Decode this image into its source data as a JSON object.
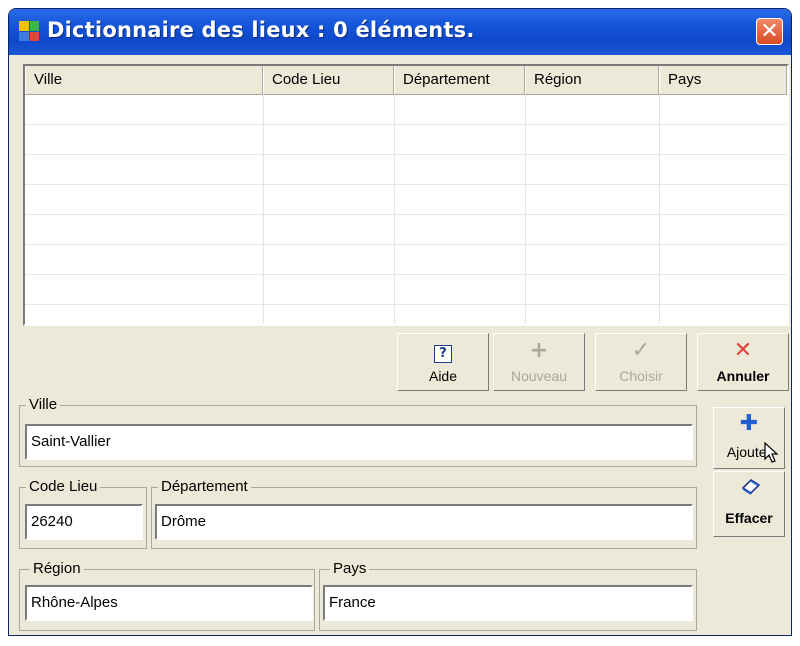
{
  "window": {
    "title": "Dictionnaire des lieux : 0 éléments.",
    "close_glyph": "✕"
  },
  "grid": {
    "columns": [
      "Ville",
      "Code Lieu",
      "Département",
      "Région",
      "Pays"
    ],
    "rows": []
  },
  "toolbar": {
    "help": {
      "label": "Aide",
      "icon": "help-icon",
      "glyph": "?"
    },
    "new": {
      "label": "Nouveau",
      "icon": "plus-icon",
      "glyph": "+",
      "disabled": true
    },
    "choose": {
      "label": "Choisir",
      "icon": "checkmark-icon",
      "glyph": "✓",
      "disabled": true
    },
    "cancel": {
      "label": "Annuler",
      "icon": "x-icon",
      "glyph": "✕"
    }
  },
  "form": {
    "ville": {
      "label": "Ville",
      "value": "Saint-Vallier"
    },
    "code_lieu": {
      "label": "Code Lieu",
      "value": "26240"
    },
    "departement": {
      "label": "Département",
      "value": "Drôme"
    },
    "region": {
      "label": "Région",
      "value": "Rhône-Alpes"
    },
    "pays": {
      "label": "Pays",
      "value": "France"
    }
  },
  "side": {
    "add": {
      "label": "Ajouter",
      "icon": "plus-icon",
      "glyph": "✚"
    },
    "clear": {
      "label": "Effacer",
      "icon": "eraser-icon"
    }
  },
  "colors": {
    "titlebar": "#0f47c8",
    "window_bg": "#ece9d8",
    "cancel_icon": "#e0443a",
    "add_icon": "#1f5fd0"
  }
}
